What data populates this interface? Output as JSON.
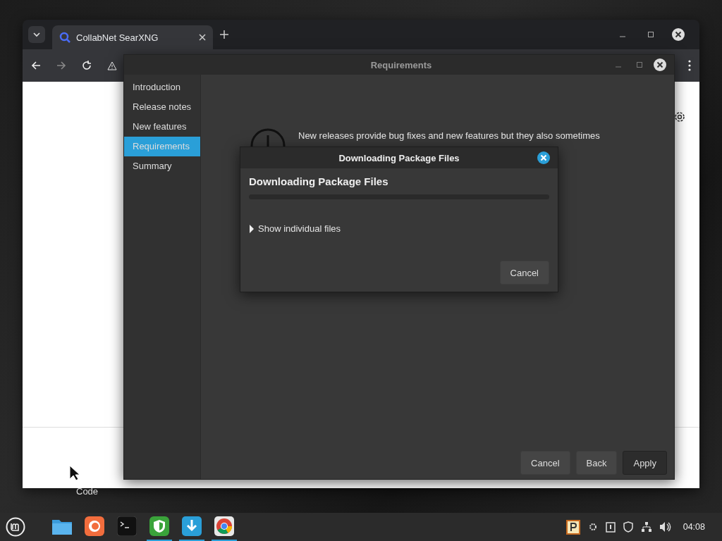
{
  "browser": {
    "tabs": [
      {
        "title": "CollabNet SearXNG",
        "selected": true
      }
    ]
  },
  "desktop_icon": {
    "label": "Code"
  },
  "requirements_window": {
    "title": "Requirements",
    "sidebar": [
      {
        "label": "Introduction",
        "selected": false
      },
      {
        "label": "Release notes",
        "selected": false
      },
      {
        "label": "New features",
        "selected": false
      },
      {
        "label": "Requirements",
        "selected": true
      },
      {
        "label": "Summary",
        "selected": false
      }
    ],
    "message": "New releases provide bug fixes and new features but they also sometimes",
    "buttons": [
      {
        "label": "Cancel",
        "kind": "normal"
      },
      {
        "label": "Back",
        "kind": "normal"
      },
      {
        "label": "Apply",
        "kind": "default"
      }
    ]
  },
  "dialog": {
    "title": "Downloading Package Files",
    "heading": "Downloading Package Files",
    "progress": {
      "level": 0
    },
    "expander": {
      "label": "Show individual files",
      "expanded": false
    },
    "cancel": "Cancel"
  },
  "taskbar": {
    "apps": [
      {
        "kind": "files",
        "active": false
      },
      {
        "kind": "firefox",
        "active": false
      },
      {
        "kind": "terminal",
        "active": false
      },
      {
        "kind": "shield",
        "active": true
      },
      {
        "kind": "download",
        "active": true
      },
      {
        "kind": "chrome",
        "active": true
      }
    ],
    "clock": "04:08"
  }
}
